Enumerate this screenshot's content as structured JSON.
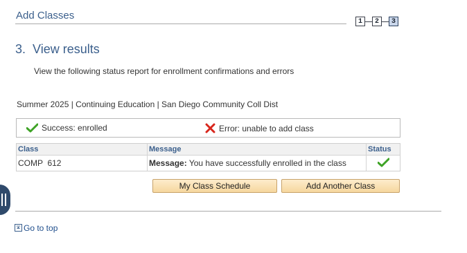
{
  "header": {
    "title": "Add Classes",
    "steps": [
      "1",
      "2",
      "3"
    ],
    "current_step": 3
  },
  "step": {
    "heading": "3.  View results",
    "instructions": "View the following status report for enrollment confirmations and errors"
  },
  "term": "Summer 2025 | Continuing Education | San Diego Community Coll Dist",
  "legend": {
    "success": "Success: enrolled",
    "error": "Error: unable to add class"
  },
  "results": {
    "columns": [
      "Class",
      "Message",
      "Status"
    ],
    "rows": [
      {
        "class": "COMP  612",
        "message_label": "Message:",
        "message": "You have successfully enrolled in the class",
        "status_icon": "check-icon"
      }
    ]
  },
  "buttons": {
    "my_schedule": "My Class Schedule",
    "add_another": "Add Another Class"
  },
  "footer": {
    "go_to_top": "Go to top"
  },
  "colors": {
    "heading_blue": "#3b5f8c",
    "success_green": "#3ea326",
    "error_red": "#d8261c",
    "button_fill": "#f6d79e"
  }
}
